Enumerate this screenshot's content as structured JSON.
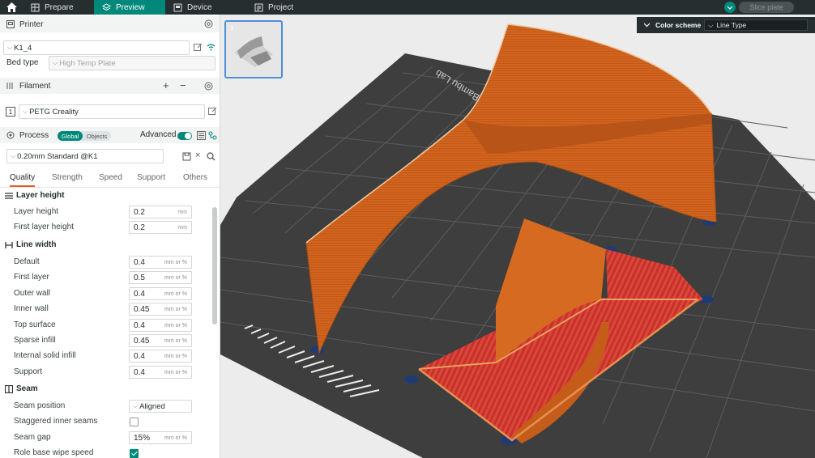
{
  "topbar": {
    "tabs": [
      {
        "label": "Prepare"
      },
      {
        "label": "Preview"
      },
      {
        "label": "Device"
      },
      {
        "label": "Project"
      }
    ],
    "slice_label": "Slice plate"
  },
  "printer": {
    "section_title": "Printer",
    "name": "K1_4",
    "bed_type_label": "Bed type",
    "bed_type_value": "High Temp Plate"
  },
  "filament": {
    "section_title": "Filament",
    "slot": "1",
    "name": "PETG Creality"
  },
  "process": {
    "section_title": "Process",
    "global_label": "Global",
    "objects_label": "Objects",
    "advanced_label": "Advanced",
    "preset": "0.20mm Standard @K1",
    "tabs": [
      "Quality",
      "Strength",
      "Speed",
      "Support",
      "Others"
    ]
  },
  "quality": {
    "layer_height_group": "Layer height",
    "layer_height": {
      "label": "Layer height",
      "value": "0.2",
      "unit": "mm"
    },
    "first_layer_height": {
      "label": "First layer height",
      "value": "0.2",
      "unit": "mm"
    },
    "line_width_group": "Line width",
    "line_widths": [
      {
        "label": "Default",
        "value": "0.4",
        "unit": "mm or %"
      },
      {
        "label": "First layer",
        "value": "0.5",
        "unit": "mm or %"
      },
      {
        "label": "Outer wall",
        "value": "0.4",
        "unit": "mm or %"
      },
      {
        "label": "Inner wall",
        "value": "0.45",
        "unit": "mm or %"
      },
      {
        "label": "Top surface",
        "value": "0.4",
        "unit": "mm or %"
      },
      {
        "label": "Sparse infill",
        "value": "0.45",
        "unit": "mm or %"
      },
      {
        "label": "Internal solid infill",
        "value": "0.4",
        "unit": "mm or %"
      },
      {
        "label": "Support",
        "value": "0.4",
        "unit": "mm or %"
      }
    ],
    "seam_group": "Seam",
    "seam_position": {
      "label": "Seam position",
      "value": "Aligned"
    },
    "staggered_inner_seams": {
      "label": "Staggered inner seams",
      "checked": false
    },
    "seam_gap": {
      "label": "Seam gap",
      "value": "15%",
      "unit": "mm or %"
    },
    "role_base_wipe_speed": {
      "label": "Role base wipe speed",
      "checked": true
    }
  },
  "viewport": {
    "plate_number": "1",
    "bed_brand": "Bambu Lab",
    "color_scheme_label": "Color scheme",
    "color_scheme_value": "Line Type"
  },
  "colors": {
    "accent": "#00897b",
    "topbar": "#262e30",
    "bed": "#3c3c3c",
    "wall": "#d0641e",
    "infill_red": "#c8302a",
    "highlight": "#e05d2e"
  }
}
